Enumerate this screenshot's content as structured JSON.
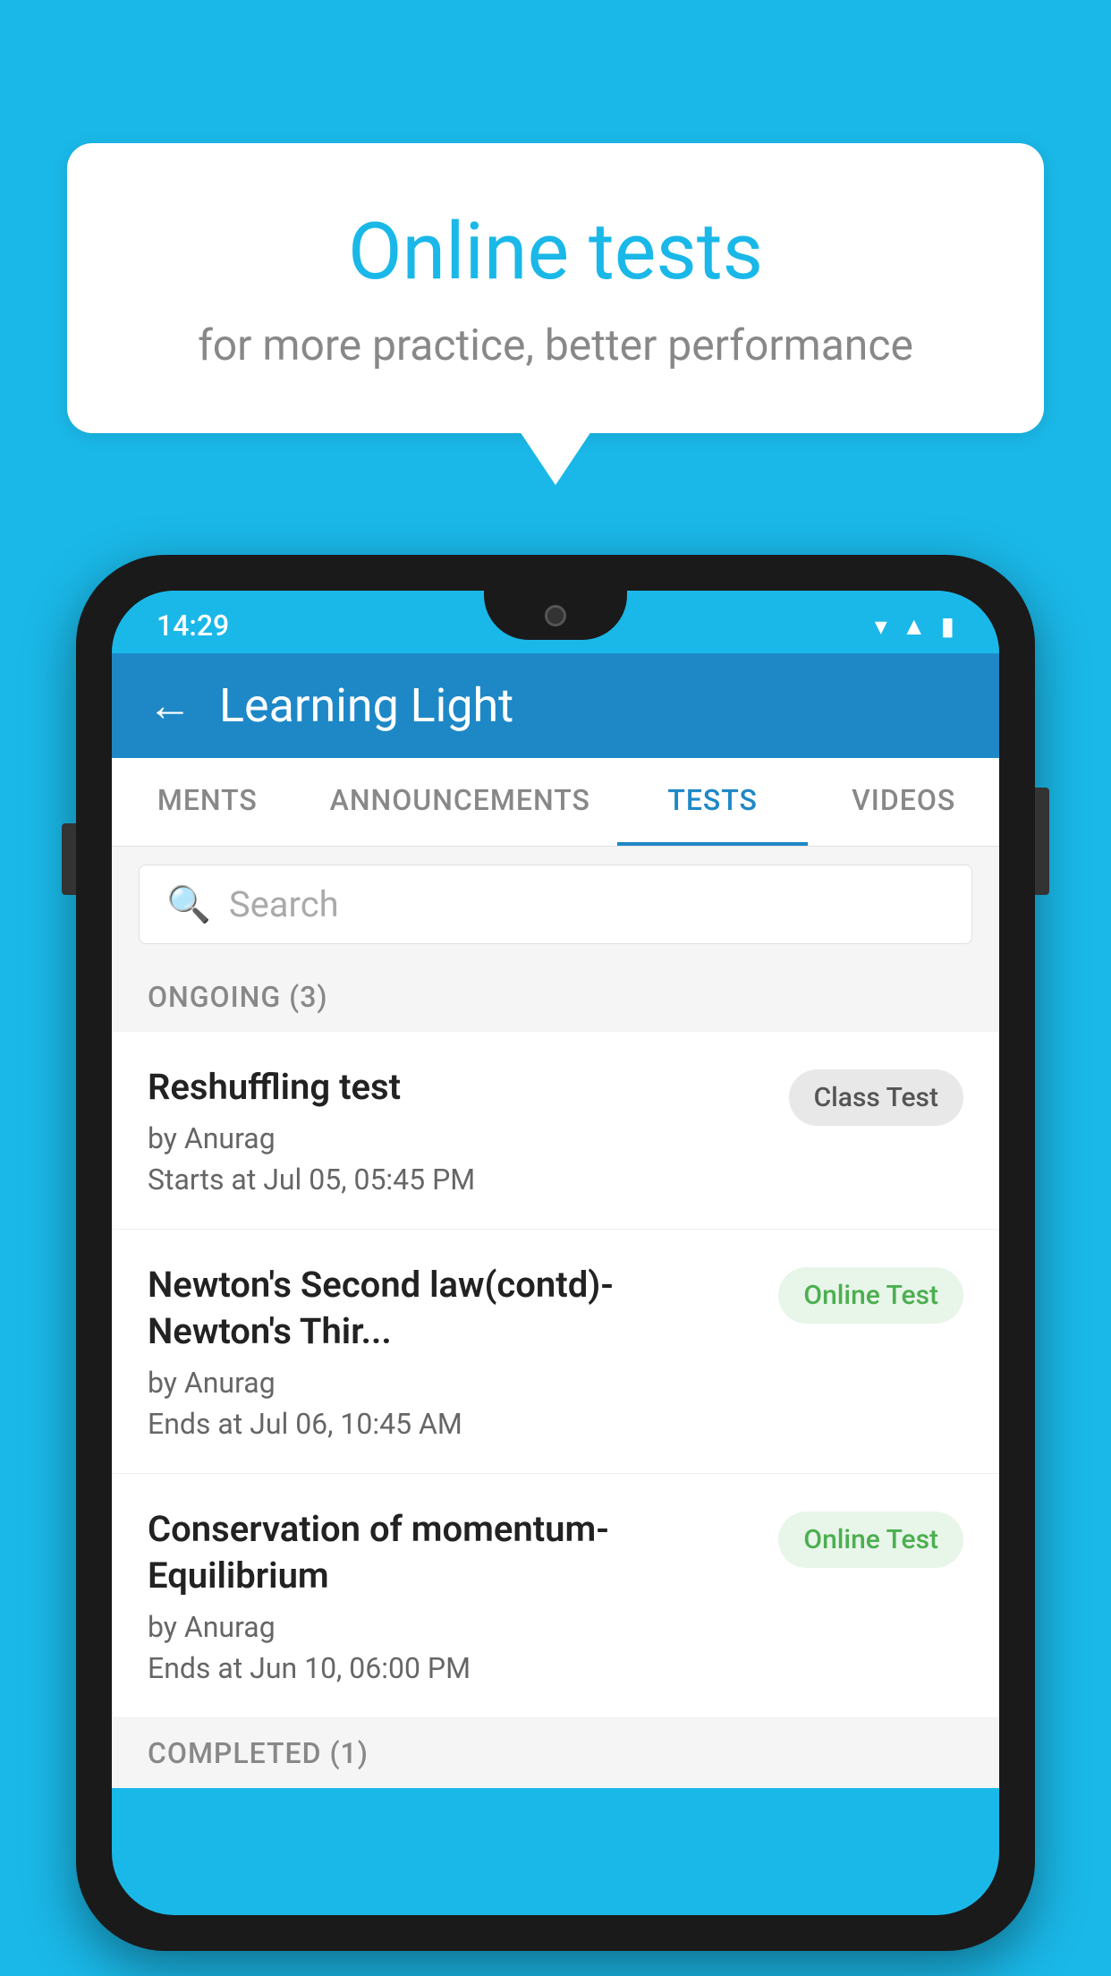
{
  "background": {
    "color": "#1ab8e8"
  },
  "speech_bubble": {
    "title": "Online tests",
    "subtitle": "for more practice, better performance"
  },
  "status_bar": {
    "time": "14:29",
    "icons": [
      "▼",
      "▲",
      "▮"
    ]
  },
  "app_header": {
    "title": "Learning Light",
    "back_label": "←"
  },
  "tabs": [
    {
      "label": "MENTS",
      "active": false
    },
    {
      "label": "ANNOUNCEMENTS",
      "active": false
    },
    {
      "label": "TESTS",
      "active": true
    },
    {
      "label": "VIDEOS",
      "active": false
    }
  ],
  "search": {
    "placeholder": "Search"
  },
  "sections": [
    {
      "label": "ONGOING (3)",
      "tests": [
        {
          "name": "Reshuffling test",
          "by": "by Anurag",
          "date": "Starts at  Jul 05, 05:45 PM",
          "badge": "Class Test",
          "badge_type": "class"
        },
        {
          "name": "Newton's Second law(contd)-Newton's Thir...",
          "by": "by Anurag",
          "date": "Ends at  Jul 06, 10:45 AM",
          "badge": "Online Test",
          "badge_type": "online"
        },
        {
          "name": "Conservation of momentum-Equilibrium",
          "by": "by Anurag",
          "date": "Ends at  Jun 10, 06:00 PM",
          "badge": "Online Test",
          "badge_type": "online"
        }
      ]
    },
    {
      "label": "COMPLETED (1)",
      "tests": []
    }
  ]
}
